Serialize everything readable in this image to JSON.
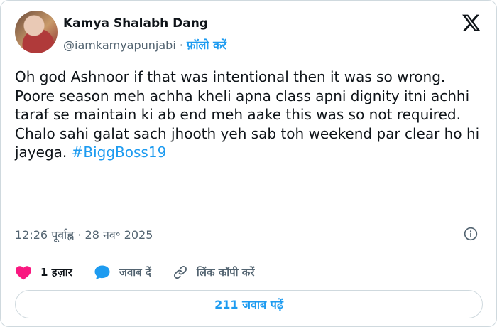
{
  "author": {
    "name": "Kamya Shalabh Dang",
    "handle": "@iamkamyapunjabi",
    "separator": " · ",
    "follow_label": "फ़ॉलो करें"
  },
  "tweet": {
    "lines": [
      "Oh god Ashnoor if that was intentional then it was so wrong.",
      "Poore season meh achha kheli apna class apni dignity itni achhi taraf se maintain ki ab end meh aake this was so not required.",
      "Chalo sahi galat sach jhooth yeh sab toh weekend par clear ho hi jayega."
    ],
    "hashtag": "#BiggBoss19"
  },
  "meta": {
    "timestamp": "12:26 पूर्वाह्न · 28 नव॰ 2025"
  },
  "actions": {
    "likes": "1 हज़ार",
    "reply_label": "जवाब दें",
    "copy_link_label": "लिंक कॉपी करें"
  },
  "replies_button": "211 जवाब पढ़ें",
  "colors": {
    "accent": "#1d9bf0",
    "like": "#f91880",
    "text": "#0f1419",
    "muted": "#536471",
    "border": "#cfd9de"
  },
  "icons": [
    "x-logo-icon",
    "info-icon",
    "heart-icon",
    "reply-bubble-icon",
    "link-icon"
  ]
}
